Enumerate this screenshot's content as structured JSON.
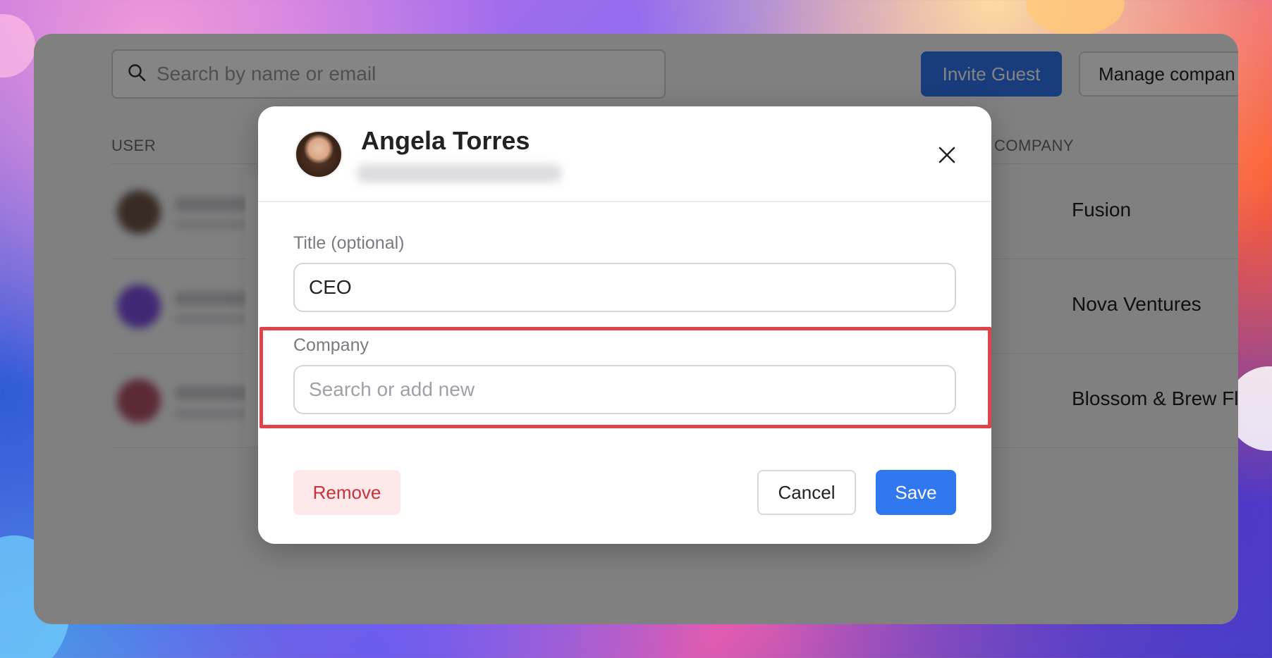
{
  "search": {
    "placeholder": "Search by name or email",
    "icon": "search-icon"
  },
  "toolbar": {
    "invite_label": "Invite Guest",
    "manage_label": "Manage compan"
  },
  "table": {
    "headers": {
      "user": "USER",
      "company": "COMPANY"
    },
    "rows": [
      {
        "company": "Fusion",
        "avatar_color": "#6b5347"
      },
      {
        "company": "Nova Ventures",
        "avatar_color": "#7a4fe0"
      },
      {
        "company": "Blossom & Brew Floral Stuc",
        "avatar_color": "#b05166"
      }
    ]
  },
  "modal": {
    "name": "Angela Torres",
    "title_label": "Title (optional)",
    "title_value": "CEO",
    "company_label": "Company",
    "company_placeholder": "Search or add new",
    "remove_label": "Remove",
    "cancel_label": "Cancel",
    "save_label": "Save",
    "close_icon": "close-icon"
  },
  "colors": {
    "highlight": "#e0434c",
    "primary": "#2f78f0",
    "danger_text": "#c8323c",
    "danger_bg": "#fde8ea"
  }
}
